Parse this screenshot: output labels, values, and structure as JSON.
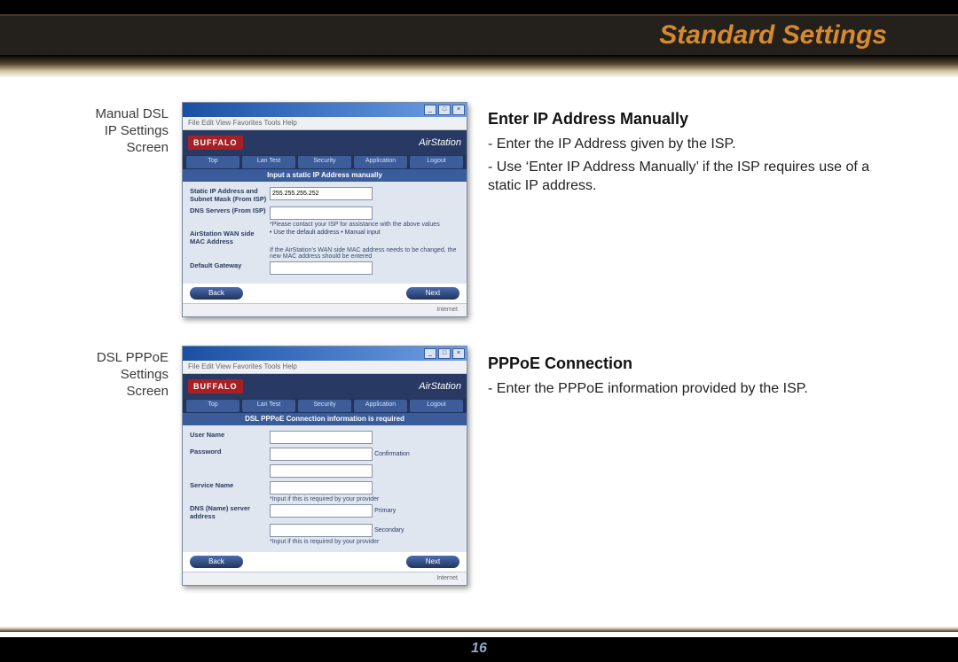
{
  "header": {
    "title": "Standard Settings"
  },
  "footer": {
    "page": "16"
  },
  "sections": [
    {
      "caption_l1": "Manual DSL",
      "caption_l2": "IP Settings",
      "caption_l3": "Screen",
      "heading": "Enter IP Address Manually",
      "lines": [
        "- Enter the IP Address given by the ISP.",
        "- Use ‘Enter IP Address Manually’ if the ISP requires use of a static IP address."
      ]
    },
    {
      "caption_l1": "DSL PPPoE",
      "caption_l2": "Settings",
      "caption_l3": "Screen",
      "heading": "PPPoE Connection",
      "lines": [
        "- Enter the PPPoE information provided by the ISP."
      ]
    }
  ],
  "shots": {
    "common": {
      "brand": "BUFFALO",
      "product": "AirStation",
      "tabs": [
        "Top",
        "Lan Test",
        "Security",
        "Application",
        "Logout"
      ],
      "back": "Back",
      "next": "Next",
      "status": "Internet"
    },
    "0": {
      "menubar": "File  Edit  View  Favorites  Tools  Help",
      "form_title": "Input a static IP Address manually",
      "rows": [
        {
          "label": "Static IP Address and Subnet Mask (From ISP)",
          "value": "255.255.255.252"
        },
        {
          "label": "DNS Servers (From ISP)",
          "hint": "*Please contact your ISP for assistance with the above values"
        },
        {
          "label": "AirStation WAN side MAC Address",
          "value": "• Use the default address  • Manual input",
          "hint": "If the AirStation's WAN side MAC address needs to be changed, the new MAC address should be entered"
        },
        {
          "label": "Default Gateway"
        }
      ]
    },
    "1": {
      "menubar": "File  Edit  View  Favorites  Tools  Help",
      "form_title": "DSL PPPoE Connection information is required",
      "rows": [
        {
          "label": "User Name"
        },
        {
          "label": "Password",
          "note": "Confirmation"
        },
        {
          "label": "Service Name",
          "hint": "*Input if this is required by your provider"
        },
        {
          "label": "DNS (Name) server address",
          "note1": "Primary",
          "note2": "Secondary",
          "hint": "*Input if this is required by your provider"
        }
      ]
    }
  }
}
